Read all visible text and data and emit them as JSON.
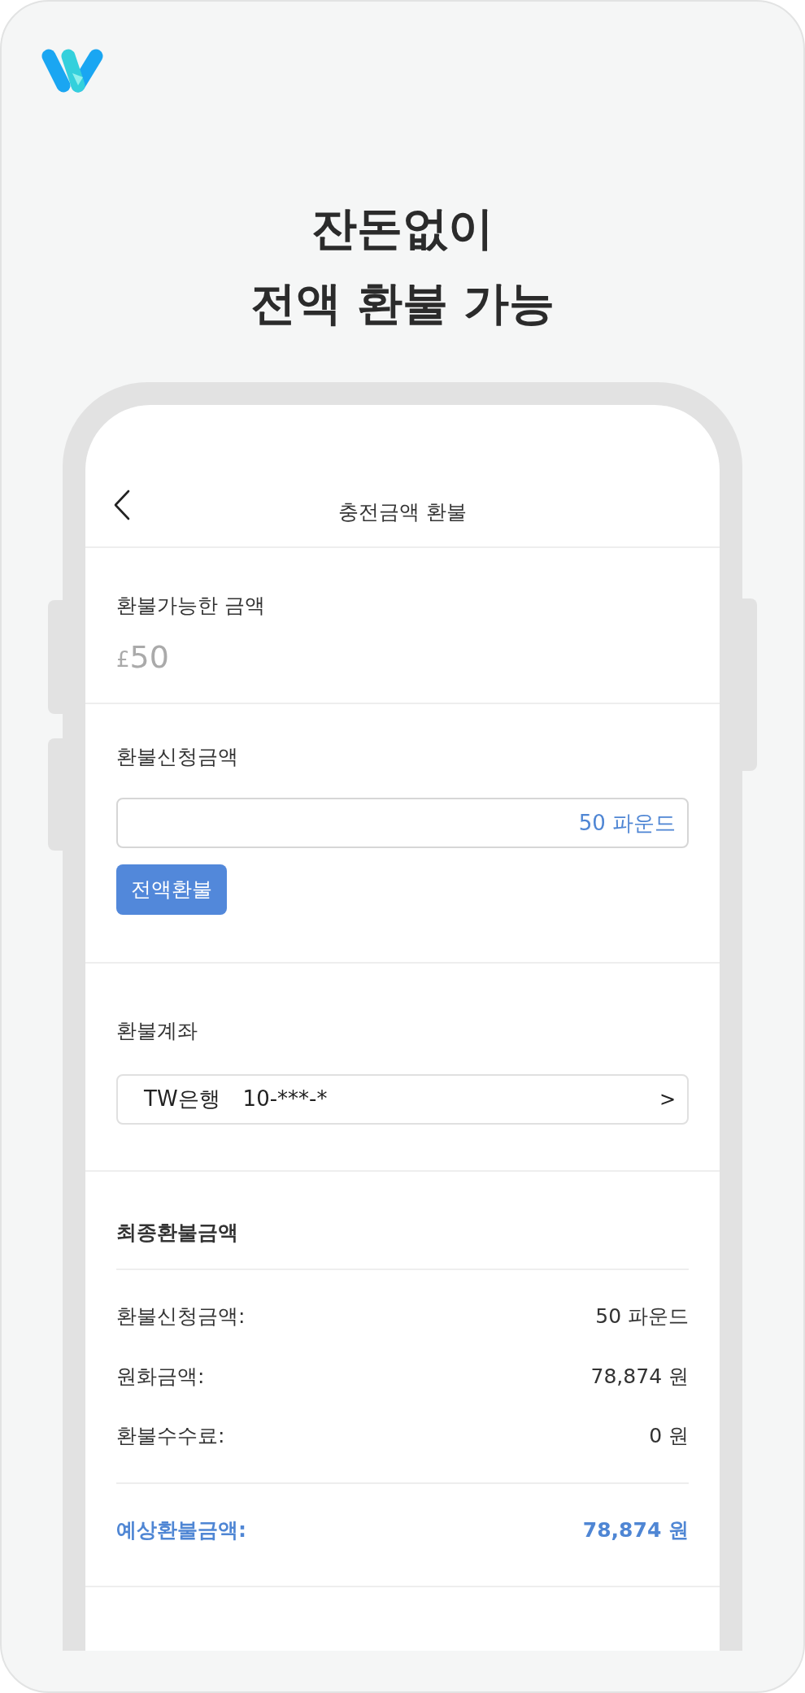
{
  "headline": [
    "잔돈없이",
    "전액 환불 가능"
  ],
  "screen": {
    "title": "충전금액 환불",
    "available": {
      "label": "환불가능한 금액",
      "currency": "£",
      "amount": "50"
    },
    "request": {
      "label": "환불신청금액",
      "value": "50 파운드",
      "button": "전액환불"
    },
    "account": {
      "label": "환불계좌",
      "bank": "TW은행",
      "number": "10-***-*",
      "chevron": ">"
    },
    "summary": {
      "title": "최종환불금액",
      "rows": [
        {
          "label": "환불신청금액:",
          "value": "50 파운드"
        },
        {
          "label": "원화금액:",
          "value": "78,874 원"
        },
        {
          "label": "환불수수료:",
          "value": "0 원"
        }
      ],
      "total": {
        "label": "예상환불금액:",
        "value": "78,874 원"
      }
    }
  }
}
